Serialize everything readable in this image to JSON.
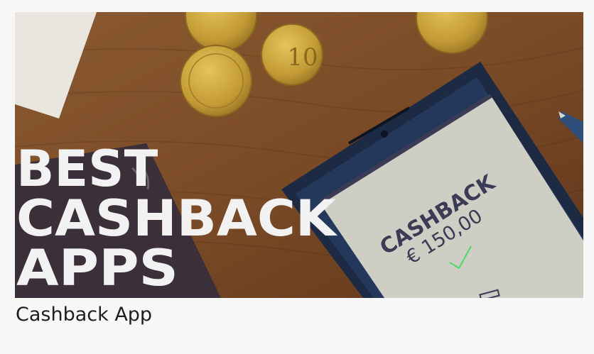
{
  "hero": {
    "headline_line1": "BEST",
    "headline_line2": "CASHBACK",
    "headline_line3": "APPS",
    "phone_title": "CASHBACK",
    "phone_amount": "€ 150,00",
    "coin_label": "10"
  },
  "caption": "Cashback App",
  "colors": {
    "wood": "#7a4a26",
    "coin": "#c9a640",
    "phone_screen": "#cfcfc6",
    "phone_text": "#3b3b55",
    "check": "#4cd964"
  }
}
